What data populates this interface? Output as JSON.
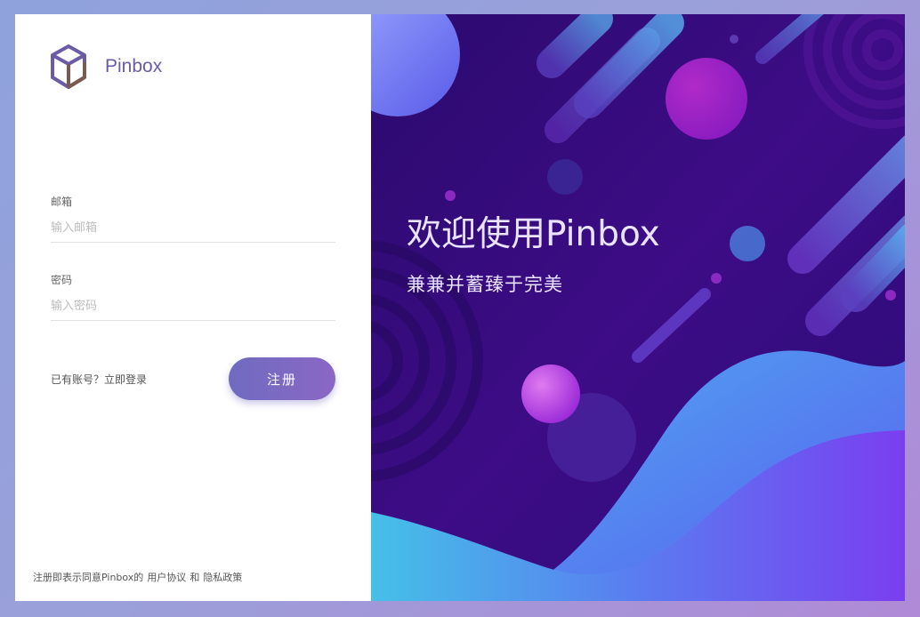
{
  "brand": {
    "name": "Pinbox",
    "logo_icon": "cube-icon"
  },
  "form": {
    "email_label": "邮箱",
    "email_placeholder": "输入邮箱",
    "password_label": "密码",
    "password_placeholder": "输入密码",
    "login_prompt": "已有账号？立即登录",
    "register_button": "注册"
  },
  "footer": {
    "terms_prefix": "注册即表示同意Pinbox的",
    "user_agreement": "用户协议",
    "and": "和",
    "privacy_policy": "隐私政策"
  },
  "hero": {
    "title": "欢迎使用Pinbox",
    "subtitle": "兼兼并蓄臻于完美"
  },
  "colors": {
    "accent": "#7b6cc4",
    "hero_bg": "#2a0a6e",
    "wave_start": "#4bb8ec",
    "wave_end": "#6d3cf0"
  }
}
